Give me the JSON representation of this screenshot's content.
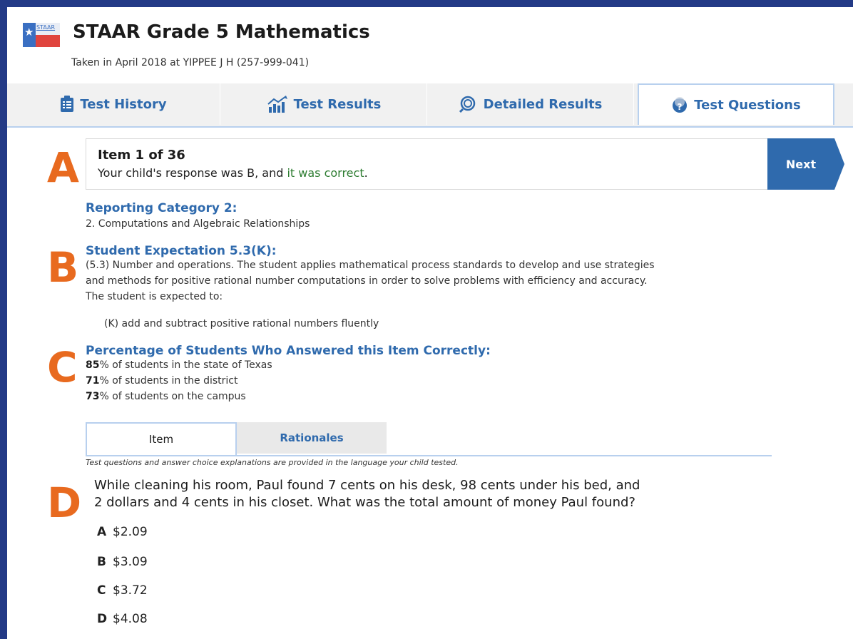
{
  "header": {
    "logo_text": "STAAR",
    "title": "STAAR Grade 5 Mathematics",
    "subtitle": "Taken in April 2018 at YIPPEE J H (257-999-041)"
  },
  "tabs": [
    {
      "label": "Test History",
      "icon": "clipboard-list-icon"
    },
    {
      "label": "Test Results",
      "icon": "bar-chart-trend-icon"
    },
    {
      "label": "Detailed Results",
      "icon": "magnifier-chart-icon"
    },
    {
      "label": "Test Questions",
      "icon": "question-circle-icon",
      "active": true
    }
  ],
  "item": {
    "title": "Item 1 of 36",
    "response_prefix": "Your child's response was B, and ",
    "response_status": "it was correct",
    "response_suffix": ".",
    "next_label": "Next"
  },
  "annotations": [
    "A",
    "B",
    "C",
    "D"
  ],
  "reporting_category": {
    "heading": "Reporting Category 2:",
    "text": "2. Computations and Algebraic Relationships"
  },
  "student_expectation": {
    "heading": "Student Expectation 5.3(K):",
    "lines": [
      "(5.3) Number and operations. The student applies mathematical process standards to develop and use strategies",
      "and methods for positive rational number computations in order to solve problems with efficiency and accuracy.",
      "The student is expected to:"
    ],
    "sub": "(K) add and subtract positive rational numbers fluently"
  },
  "percentages": {
    "heading": "Percentage of Students Who Answered this Item Correctly:",
    "rows": [
      {
        "value": "85",
        "text": "% of students in the state of Texas"
      },
      {
        "value": "71",
        "text": "% of students in the district"
      },
      {
        "value": "73",
        "text": "% of students on the campus"
      }
    ]
  },
  "subtabs": {
    "item": "Item",
    "rationales": "Rationales"
  },
  "note": "Test questions and answer choice explanations are provided in the language your child tested.",
  "question": {
    "lines": [
      "While cleaning his room, Paul found 7 cents on his desk, 98 cents under his bed, and",
      "2 dollars and 4 cents in his closet. What was the total amount of money Paul found?"
    ],
    "choices": [
      {
        "letter": "A",
        "text": "$2.09"
      },
      {
        "letter": "B",
        "text": "$3.09"
      },
      {
        "letter": "C",
        "text": "$3.72"
      },
      {
        "letter": "D",
        "text": "$4.08"
      }
    ]
  },
  "colors": {
    "frame": "#233a86",
    "accent_blue": "#2f6aad",
    "annotation_orange": "#e86a1f",
    "correct_green": "#2e7d32"
  }
}
